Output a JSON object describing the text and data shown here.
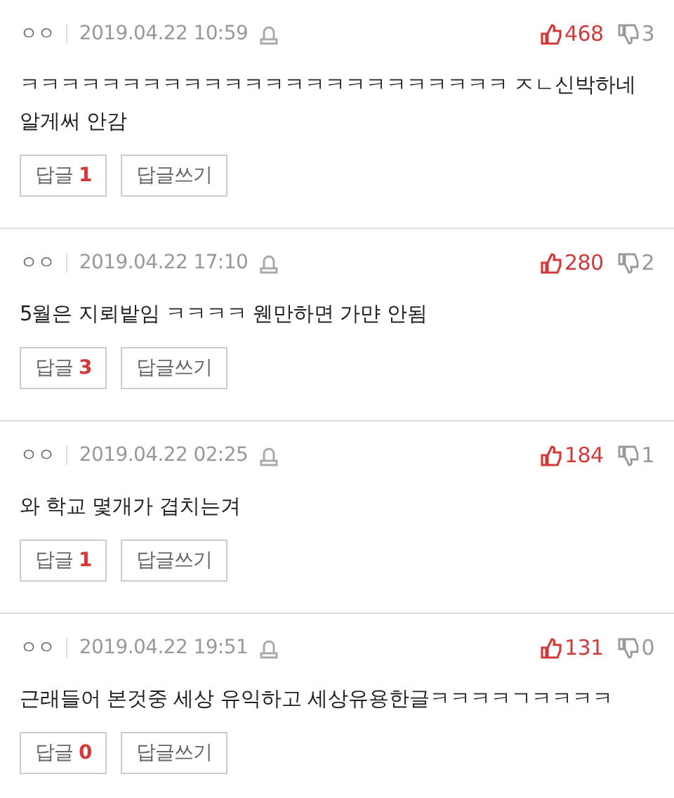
{
  "comments": [
    {
      "author": "ㅇㅇ",
      "date": "2019.04.22 10:59",
      "likes": "468",
      "dislikes": "3",
      "text": "ㅋㅋㅋㅋㅋㅋㅋㅋㅋㅋㅋㅋㅋㅋㅋㅋㅋㅋㅋㅋㅋㅋㅋㅋ ㅈㄴ신박하네 알게써 안감",
      "reply_label": "답글",
      "reply_count": "1",
      "write_label": "답글쓰기"
    },
    {
      "author": "ㅇㅇ",
      "date": "2019.04.22 17:10",
      "likes": "280",
      "dislikes": "2",
      "text": "5월은 지뢰밭임 ㅋㅋㅋㅋ 웬만하면 가먄 안됨",
      "reply_label": "답글",
      "reply_count": "3",
      "write_label": "답글쓰기"
    },
    {
      "author": "ㅇㅇ",
      "date": "2019.04.22 02:25",
      "likes": "184",
      "dislikes": "1",
      "text": "와 학교 몇개가 겹치는겨",
      "reply_label": "답글",
      "reply_count": "1",
      "write_label": "답글쓰기"
    },
    {
      "author": "ㅇㅇ",
      "date": "2019.04.22 19:51",
      "likes": "131",
      "dislikes": "0",
      "text": "근래들어 본것중 세상 유익하고 세상유용한글ㅋㅋㅋㅋㄱㅋㅋㅋㅋ",
      "reply_label": "답글",
      "reply_count": "0",
      "write_label": "답글쓰기"
    }
  ]
}
